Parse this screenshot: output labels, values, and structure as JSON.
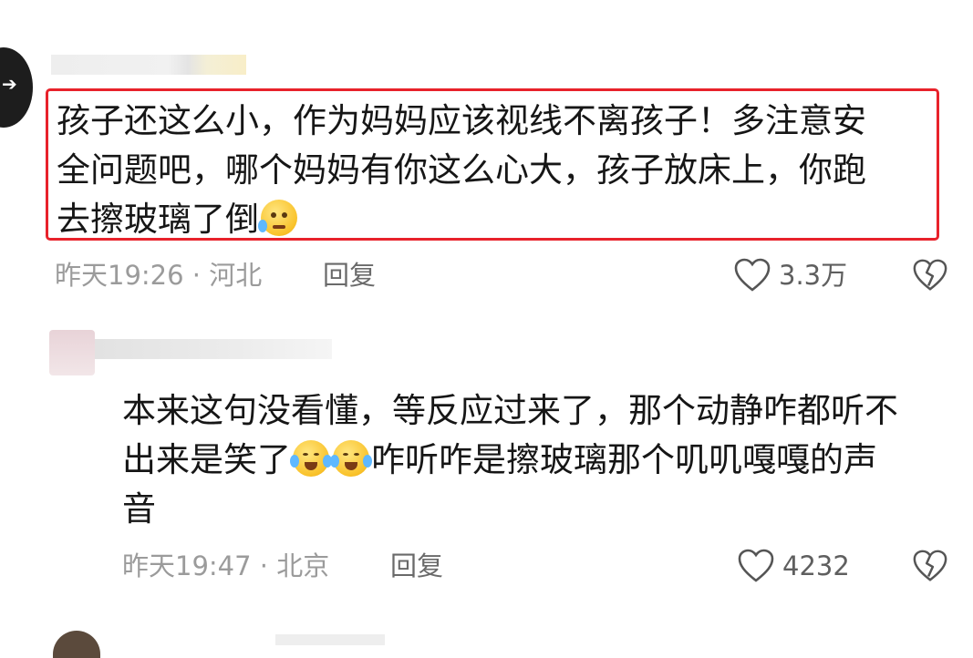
{
  "comments": [
    {
      "text_lines": [
        "孩子还这么小，作为妈妈应该视线不离孩子！多注意安",
        "全问题吧，哪个妈妈有你这么心大，孩子放床上，你跑",
        "去擦玻璃了倒"
      ],
      "emoji_icon": "pleading-face-icon",
      "meta": "昨天19:26 · 河北",
      "reply_label": "回复",
      "likes": "3.3万"
    },
    {
      "text_lines": [
        "本来这句没看懂，等反应过来了，那个动静咋都听不",
        "出来是笑了",
        "咋听咋是擦玻璃那个叽叽嘎嘎的声",
        "音"
      ],
      "emoji_icon": "tears-of-joy-icon",
      "meta": "昨天19:47 · 北京",
      "reply_label": "回复",
      "likes": "4232"
    }
  ],
  "highlight_color": "#e8222b"
}
